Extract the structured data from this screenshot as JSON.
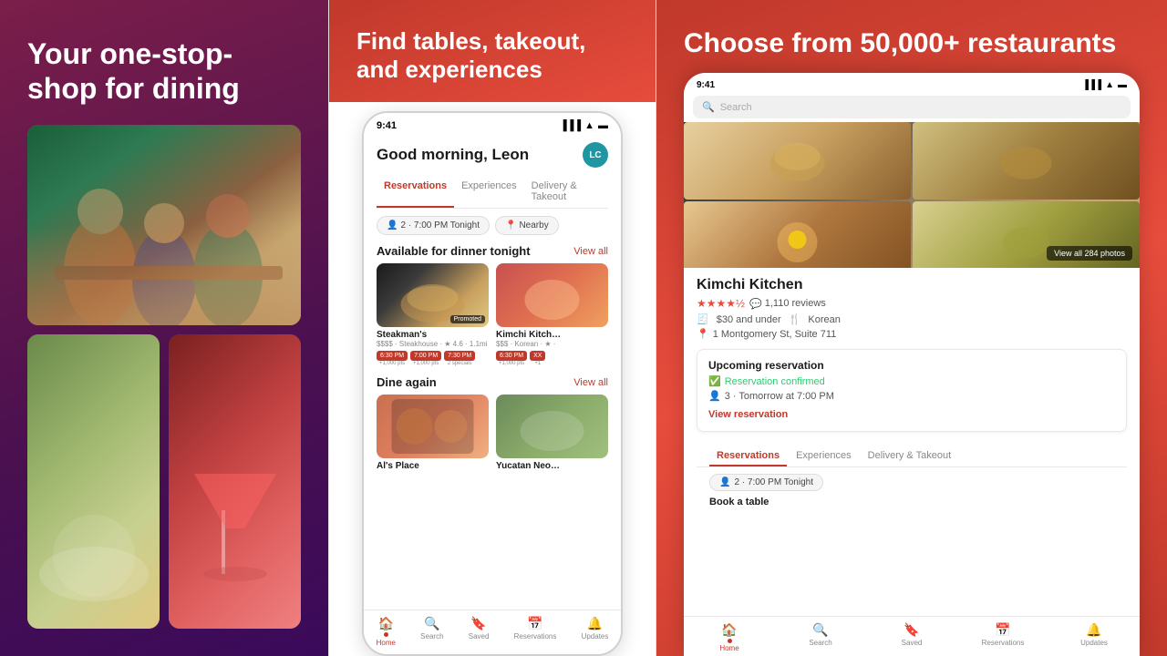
{
  "panel1": {
    "headline": "Your one-stop-shop for dining"
  },
  "panel2": {
    "headline": "Find tables, takeout, and experiences",
    "phone": {
      "time": "9:41",
      "greeting": "Good morning, Leon",
      "avatar_initials": "LC",
      "tabs": [
        {
          "label": "Reservations",
          "active": true
        },
        {
          "label": "Experiences",
          "active": false
        },
        {
          "label": "Delivery & Takeout",
          "active": false
        }
      ],
      "filters": [
        {
          "label": "2 · 7:00 PM Tonight",
          "icon": "person"
        },
        {
          "label": "Nearby",
          "icon": "location"
        }
      ],
      "section1_title": "Available for dinner tonight",
      "section1_view_all": "View all",
      "restaurants": [
        {
          "name": "Steakman's",
          "meta": "$$$$ · Steakhouse · ★ 4.6 · 1.1mi",
          "promoted": true,
          "times": [
            "6:30 PM",
            "7:00 PM",
            "7:30 PM"
          ],
          "pts": "+1,000 pts"
        },
        {
          "name": "Kimchi Kitch…",
          "meta": "$$$ · Korean · ★ ·",
          "promoted": false,
          "times": [
            "6:30 PM",
            "XX"
          ],
          "pts": "+1,000 pts"
        }
      ],
      "section2_title": "Dine again",
      "section2_view_all": "View all",
      "bottom_nav": [
        {
          "label": "Home",
          "active": true,
          "icon": "🏠"
        },
        {
          "label": "Search",
          "active": false,
          "icon": "🔍"
        },
        {
          "label": "Saved",
          "active": false,
          "icon": "🔖"
        },
        {
          "label": "Reservations",
          "active": false,
          "icon": "📅"
        },
        {
          "label": "Updates",
          "active": false,
          "icon": "🔔"
        }
      ]
    }
  },
  "panel3": {
    "headline": "Choose from 50,000+ restaurants",
    "phone": {
      "time": "9:41",
      "search_placeholder": "Search",
      "restaurant_name": "Kimchi Kitchen",
      "stars": "★★★★½",
      "reviews_icon": "💬",
      "reviews_count": "1,110 reviews",
      "price_range": "$30 and under",
      "cuisine": "Korean",
      "address": "1 Montgomery St, Suite 711",
      "view_photos": "View all 284 photos",
      "upcoming_label": "Upcoming reservation",
      "confirmed_label": "Reservation confirmed",
      "time_label": "3 · Tomorrow at 7:00 PM",
      "view_reservation_label": "View reservation",
      "tabs": [
        {
          "label": "Reservations",
          "active": true
        },
        {
          "label": "Experiences",
          "active": false
        },
        {
          "label": "Delivery & Takeout",
          "active": false
        }
      ],
      "time_filter": "2 · 7:00 PM Tonight",
      "book_label": "Book a table",
      "bottom_nav": [
        {
          "label": "Home",
          "active": true,
          "icon": "🏠"
        },
        {
          "label": "Search",
          "active": false,
          "icon": "🔍"
        },
        {
          "label": "Saved",
          "active": false,
          "icon": "🔖"
        },
        {
          "label": "Reservations",
          "active": false,
          "icon": "📅"
        },
        {
          "label": "Updates",
          "active": false,
          "icon": "🔔"
        }
      ]
    }
  }
}
